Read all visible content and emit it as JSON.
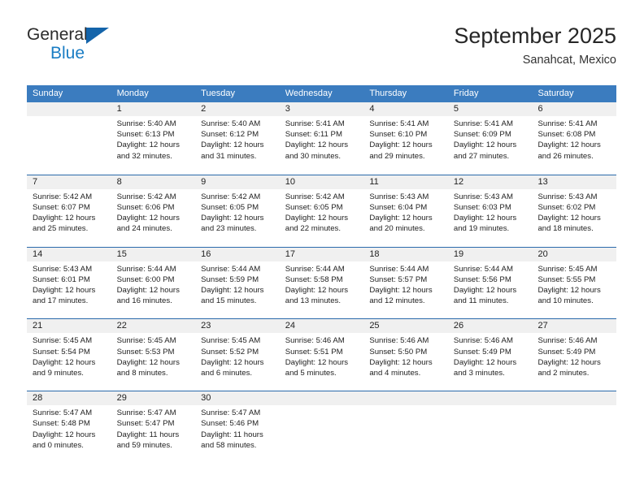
{
  "brand": {
    "name_top": "General",
    "name_bottom": "Blue",
    "accent_color": "#1a7dc4",
    "triangle_color": "#1464aa"
  },
  "header": {
    "title": "September 2025",
    "subtitle": "Sanahcat, Mexico"
  },
  "theme": {
    "header_bg": "#3b7cbf",
    "row_divider": "#2a6aab",
    "day_band_bg": "#f0f0f0"
  },
  "weekdays": [
    "Sunday",
    "Monday",
    "Tuesday",
    "Wednesday",
    "Thursday",
    "Friday",
    "Saturday"
  ],
  "weeks": [
    [
      {
        "day": "",
        "sunrise": "",
        "sunset": "",
        "daylight_line1": "",
        "daylight_line2": ""
      },
      {
        "day": "1",
        "sunrise": "Sunrise: 5:40 AM",
        "sunset": "Sunset: 6:13 PM",
        "daylight_line1": "Daylight: 12 hours",
        "daylight_line2": "and 32 minutes."
      },
      {
        "day": "2",
        "sunrise": "Sunrise: 5:40 AM",
        "sunset": "Sunset: 6:12 PM",
        "daylight_line1": "Daylight: 12 hours",
        "daylight_line2": "and 31 minutes."
      },
      {
        "day": "3",
        "sunrise": "Sunrise: 5:41 AM",
        "sunset": "Sunset: 6:11 PM",
        "daylight_line1": "Daylight: 12 hours",
        "daylight_line2": "and 30 minutes."
      },
      {
        "day": "4",
        "sunrise": "Sunrise: 5:41 AM",
        "sunset": "Sunset: 6:10 PM",
        "daylight_line1": "Daylight: 12 hours",
        "daylight_line2": "and 29 minutes."
      },
      {
        "day": "5",
        "sunrise": "Sunrise: 5:41 AM",
        "sunset": "Sunset: 6:09 PM",
        "daylight_line1": "Daylight: 12 hours",
        "daylight_line2": "and 27 minutes."
      },
      {
        "day": "6",
        "sunrise": "Sunrise: 5:41 AM",
        "sunset": "Sunset: 6:08 PM",
        "daylight_line1": "Daylight: 12 hours",
        "daylight_line2": "and 26 minutes."
      }
    ],
    [
      {
        "day": "7",
        "sunrise": "Sunrise: 5:42 AM",
        "sunset": "Sunset: 6:07 PM",
        "daylight_line1": "Daylight: 12 hours",
        "daylight_line2": "and 25 minutes."
      },
      {
        "day": "8",
        "sunrise": "Sunrise: 5:42 AM",
        "sunset": "Sunset: 6:06 PM",
        "daylight_line1": "Daylight: 12 hours",
        "daylight_line2": "and 24 minutes."
      },
      {
        "day": "9",
        "sunrise": "Sunrise: 5:42 AM",
        "sunset": "Sunset: 6:05 PM",
        "daylight_line1": "Daylight: 12 hours",
        "daylight_line2": "and 23 minutes."
      },
      {
        "day": "10",
        "sunrise": "Sunrise: 5:42 AM",
        "sunset": "Sunset: 6:05 PM",
        "daylight_line1": "Daylight: 12 hours",
        "daylight_line2": "and 22 minutes."
      },
      {
        "day": "11",
        "sunrise": "Sunrise: 5:43 AM",
        "sunset": "Sunset: 6:04 PM",
        "daylight_line1": "Daylight: 12 hours",
        "daylight_line2": "and 20 minutes."
      },
      {
        "day": "12",
        "sunrise": "Sunrise: 5:43 AM",
        "sunset": "Sunset: 6:03 PM",
        "daylight_line1": "Daylight: 12 hours",
        "daylight_line2": "and 19 minutes."
      },
      {
        "day": "13",
        "sunrise": "Sunrise: 5:43 AM",
        "sunset": "Sunset: 6:02 PM",
        "daylight_line1": "Daylight: 12 hours",
        "daylight_line2": "and 18 minutes."
      }
    ],
    [
      {
        "day": "14",
        "sunrise": "Sunrise: 5:43 AM",
        "sunset": "Sunset: 6:01 PM",
        "daylight_line1": "Daylight: 12 hours",
        "daylight_line2": "and 17 minutes."
      },
      {
        "day": "15",
        "sunrise": "Sunrise: 5:44 AM",
        "sunset": "Sunset: 6:00 PM",
        "daylight_line1": "Daylight: 12 hours",
        "daylight_line2": "and 16 minutes."
      },
      {
        "day": "16",
        "sunrise": "Sunrise: 5:44 AM",
        "sunset": "Sunset: 5:59 PM",
        "daylight_line1": "Daylight: 12 hours",
        "daylight_line2": "and 15 minutes."
      },
      {
        "day": "17",
        "sunrise": "Sunrise: 5:44 AM",
        "sunset": "Sunset: 5:58 PM",
        "daylight_line1": "Daylight: 12 hours",
        "daylight_line2": "and 13 minutes."
      },
      {
        "day": "18",
        "sunrise": "Sunrise: 5:44 AM",
        "sunset": "Sunset: 5:57 PM",
        "daylight_line1": "Daylight: 12 hours",
        "daylight_line2": "and 12 minutes."
      },
      {
        "day": "19",
        "sunrise": "Sunrise: 5:44 AM",
        "sunset": "Sunset: 5:56 PM",
        "daylight_line1": "Daylight: 12 hours",
        "daylight_line2": "and 11 minutes."
      },
      {
        "day": "20",
        "sunrise": "Sunrise: 5:45 AM",
        "sunset": "Sunset: 5:55 PM",
        "daylight_line1": "Daylight: 12 hours",
        "daylight_line2": "and 10 minutes."
      }
    ],
    [
      {
        "day": "21",
        "sunrise": "Sunrise: 5:45 AM",
        "sunset": "Sunset: 5:54 PM",
        "daylight_line1": "Daylight: 12 hours",
        "daylight_line2": "and 9 minutes."
      },
      {
        "day": "22",
        "sunrise": "Sunrise: 5:45 AM",
        "sunset": "Sunset: 5:53 PM",
        "daylight_line1": "Daylight: 12 hours",
        "daylight_line2": "and 8 minutes."
      },
      {
        "day": "23",
        "sunrise": "Sunrise: 5:45 AM",
        "sunset": "Sunset: 5:52 PM",
        "daylight_line1": "Daylight: 12 hours",
        "daylight_line2": "and 6 minutes."
      },
      {
        "day": "24",
        "sunrise": "Sunrise: 5:46 AM",
        "sunset": "Sunset: 5:51 PM",
        "daylight_line1": "Daylight: 12 hours",
        "daylight_line2": "and 5 minutes."
      },
      {
        "day": "25",
        "sunrise": "Sunrise: 5:46 AM",
        "sunset": "Sunset: 5:50 PM",
        "daylight_line1": "Daylight: 12 hours",
        "daylight_line2": "and 4 minutes."
      },
      {
        "day": "26",
        "sunrise": "Sunrise: 5:46 AM",
        "sunset": "Sunset: 5:49 PM",
        "daylight_line1": "Daylight: 12 hours",
        "daylight_line2": "and 3 minutes."
      },
      {
        "day": "27",
        "sunrise": "Sunrise: 5:46 AM",
        "sunset": "Sunset: 5:49 PM",
        "daylight_line1": "Daylight: 12 hours",
        "daylight_line2": "and 2 minutes."
      }
    ],
    [
      {
        "day": "28",
        "sunrise": "Sunrise: 5:47 AM",
        "sunset": "Sunset: 5:48 PM",
        "daylight_line1": "Daylight: 12 hours",
        "daylight_line2": "and 0 minutes."
      },
      {
        "day": "29",
        "sunrise": "Sunrise: 5:47 AM",
        "sunset": "Sunset: 5:47 PM",
        "daylight_line1": "Daylight: 11 hours",
        "daylight_line2": "and 59 minutes."
      },
      {
        "day": "30",
        "sunrise": "Sunrise: 5:47 AM",
        "sunset": "Sunset: 5:46 PM",
        "daylight_line1": "Daylight: 11 hours",
        "daylight_line2": "and 58 minutes."
      },
      {
        "day": "",
        "sunrise": "",
        "sunset": "",
        "daylight_line1": "",
        "daylight_line2": ""
      },
      {
        "day": "",
        "sunrise": "",
        "sunset": "",
        "daylight_line1": "",
        "daylight_line2": ""
      },
      {
        "day": "",
        "sunrise": "",
        "sunset": "",
        "daylight_line1": "",
        "daylight_line2": ""
      },
      {
        "day": "",
        "sunrise": "",
        "sunset": "",
        "daylight_line1": "",
        "daylight_line2": ""
      }
    ]
  ]
}
